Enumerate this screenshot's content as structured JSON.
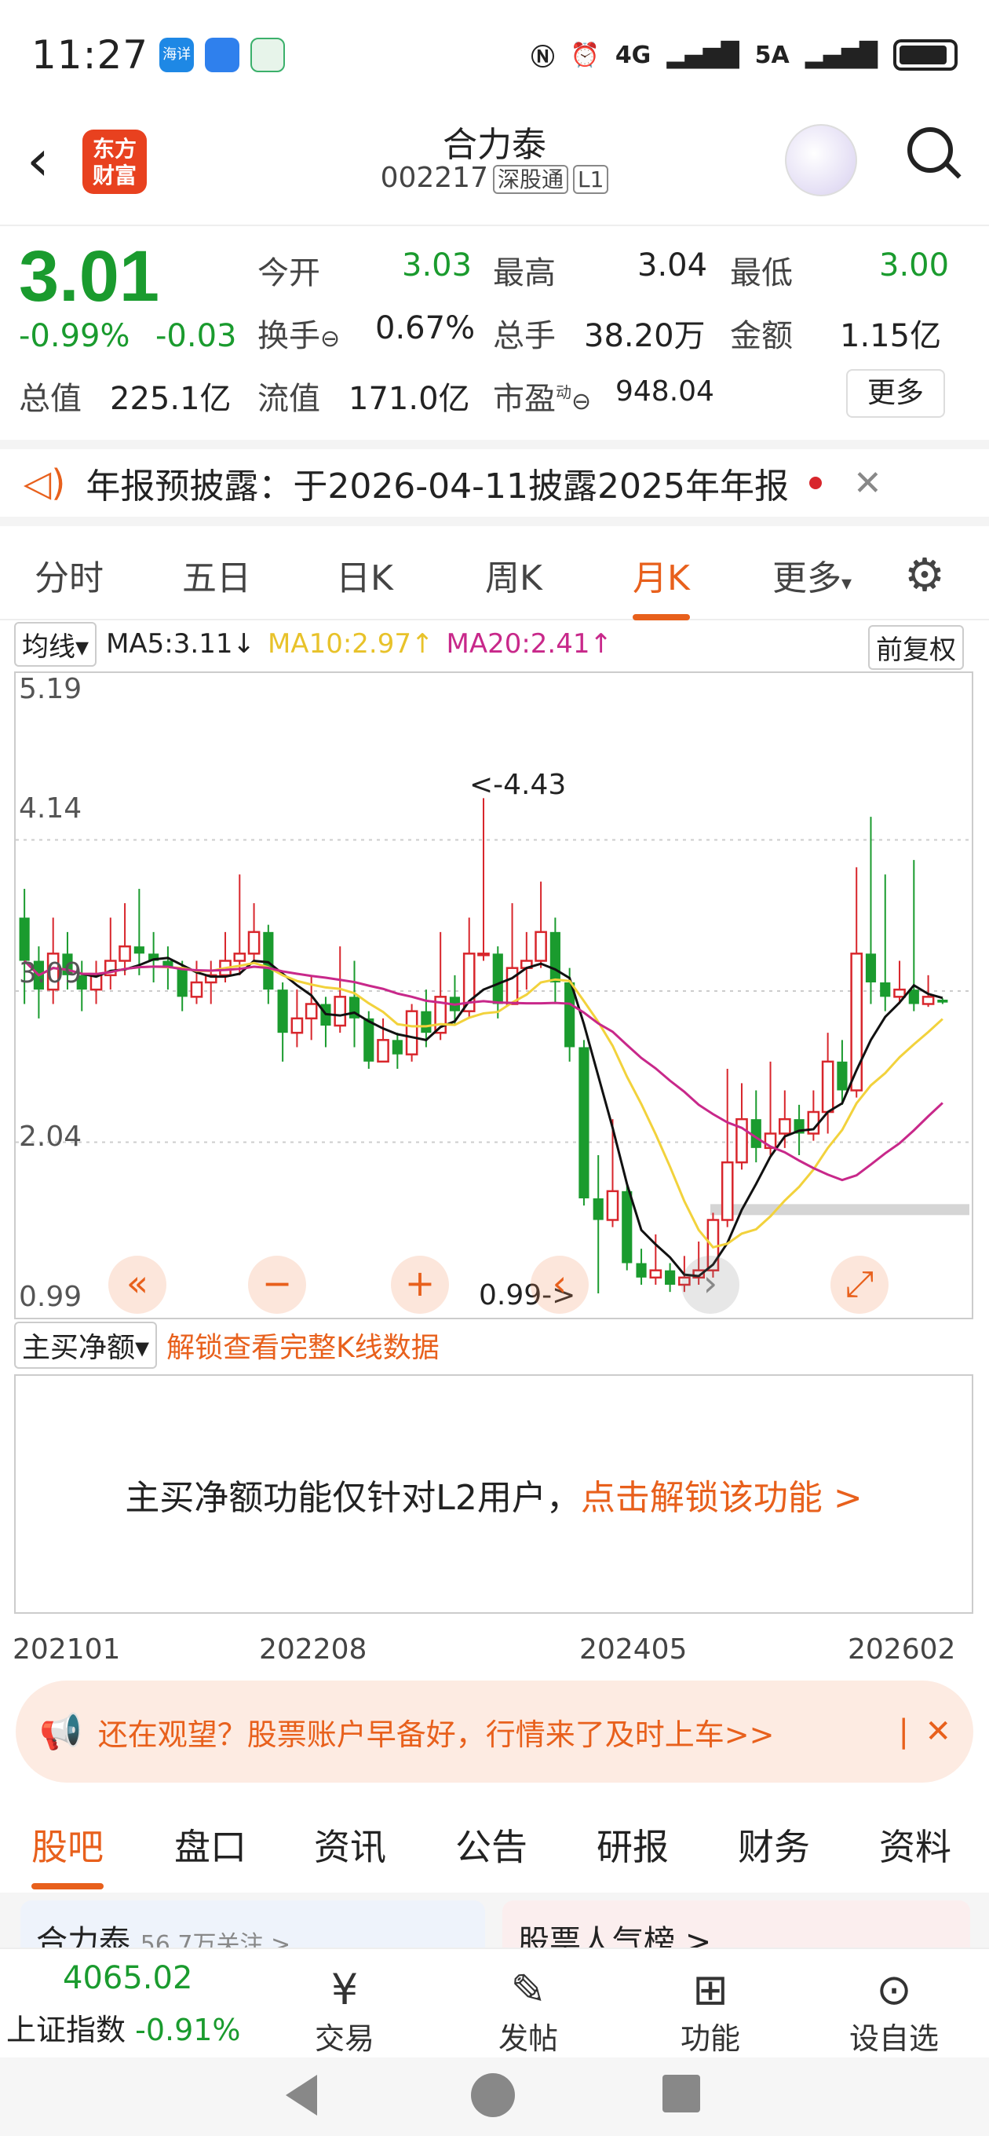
{
  "status_bar": {
    "time": "11:27",
    "apps": [
      "海详",
      "messages",
      "green-app"
    ],
    "network": "4G",
    "network2": "5A"
  },
  "header": {
    "logo_text": "东方财富",
    "stock_name": "合力泰",
    "stock_code": "002217",
    "tag1": "深股通",
    "tag2": "L1"
  },
  "quote": {
    "price": "3.01",
    "change_pct": "-0.99%",
    "change": "-0.03",
    "open_label": "今开",
    "open": "3.03",
    "high_label": "最高",
    "high": "3.04",
    "low_label": "最低",
    "low": "3.00",
    "turnover_label": "换手",
    "turnover": "0.67%",
    "volume_label": "总手",
    "volume": "38.20万",
    "amount_label": "金额",
    "amount": "1.15亿",
    "mktcap_label": "总值",
    "mktcap": "225.1亿",
    "float_label": "流值",
    "float_cap": "171.0亿",
    "pe_label": "市盈",
    "pe_sup": "动",
    "pe": "948.04",
    "more": "更多"
  },
  "notice": {
    "text": "年报预披露：于2026-04-11披露2025年年报"
  },
  "tabs": [
    "分时",
    "五日",
    "日K",
    "周K",
    "月K",
    "更多"
  ],
  "active_tab": "月K",
  "ma": {
    "selector": "均线",
    "ma5": "MA5:3.11",
    "ma10": "MA10:2.97",
    "ma20": "MA20:2.41",
    "adjust": "前复权"
  },
  "chart_labels": {
    "y_top": "5.19",
    "y2": "4.14",
    "y3": "3.09",
    "y4": "2.04",
    "y_bottom": "0.99",
    "max_mark": "<-4.43",
    "min_mark": "0.99->"
  },
  "indicator": {
    "selector": "主买净额",
    "unlock_link": "解锁查看完整K线数据",
    "msg": "主买净额功能仅针对L2用户，",
    "msg_link": "点击解锁该功能 >"
  },
  "x_dates": [
    "202101",
    "202208",
    "202405",
    "202602"
  ],
  "banner": {
    "text": "还在观望？股票账户早备好，行情来了及时上车>>"
  },
  "bottom_tabs": [
    "股吧",
    "盘口",
    "资讯",
    "公告",
    "研报",
    "财务",
    "资料"
  ],
  "cards": {
    "left": "合力泰",
    "left_sub": "56.7万关注 >",
    "right": "股票人气榜 >"
  },
  "bottom_bar": {
    "index_value": "4065.02",
    "index_name": "上证指数",
    "index_change": "-0.91%",
    "trade": "交易",
    "post": "发帖",
    "func": "功能",
    "watch": "设自选"
  },
  "colors": {
    "up": "#d8262c",
    "down": "#1a9b2e",
    "ma5": "#111111",
    "ma10": "#f2d23c",
    "ma20": "#c8288a",
    "accent": "#e8601c"
  },
  "chart_data": {
    "type": "candlestick",
    "ylim": [
      0.99,
      5.19
    ],
    "yticks": [
      5.19,
      4.14,
      3.09,
      2.04,
      0.99
    ],
    "candles": [
      [
        3.6,
        3.3,
        3.8,
        3.0
      ],
      [
        3.3,
        3.1,
        3.4,
        2.9
      ],
      [
        3.1,
        3.35,
        3.6,
        3.0
      ],
      [
        3.35,
        3.2,
        3.5,
        3.1
      ],
      [
        3.2,
        3.1,
        3.3,
        2.95
      ],
      [
        3.1,
        3.2,
        3.3,
        3.0
      ],
      [
        3.2,
        3.3,
        3.6,
        3.1
      ],
      [
        3.3,
        3.4,
        3.7,
        3.2
      ],
      [
        3.4,
        3.35,
        3.8,
        3.2
      ],
      [
        3.35,
        3.3,
        3.5,
        3.15
      ],
      [
        3.3,
        3.25,
        3.4,
        3.1
      ],
      [
        3.25,
        3.05,
        3.3,
        2.95
      ],
      [
        3.05,
        3.15,
        3.3,
        3.0
      ],
      [
        3.15,
        3.2,
        3.3,
        3.0
      ],
      [
        3.2,
        3.3,
        3.5,
        3.15
      ],
      [
        3.3,
        3.35,
        3.9,
        3.2
      ],
      [
        3.35,
        3.5,
        3.7,
        3.3
      ],
      [
        3.5,
        3.1,
        3.55,
        3.0
      ],
      [
        3.1,
        2.8,
        3.15,
        2.6
      ],
      [
        2.8,
        2.9,
        3.1,
        2.7
      ],
      [
        2.9,
        3.0,
        3.2,
        2.75
      ],
      [
        3.0,
        2.85,
        3.05,
        2.7
      ],
      [
        2.85,
        3.05,
        3.4,
        2.8
      ],
      [
        3.05,
        2.9,
        3.3,
        2.7
      ],
      [
        2.9,
        2.6,
        2.95,
        2.55
      ],
      [
        2.6,
        2.75,
        2.9,
        2.6
      ],
      [
        2.75,
        2.65,
        2.8,
        2.55
      ],
      [
        2.65,
        2.95,
        3.0,
        2.6
      ],
      [
        2.95,
        2.8,
        3.1,
        2.7
      ],
      [
        2.8,
        3.05,
        3.5,
        2.75
      ],
      [
        3.05,
        2.95,
        3.2,
        2.85
      ],
      [
        2.95,
        3.35,
        3.6,
        2.9
      ],
      [
        3.35,
        3.35,
        4.43,
        3.3
      ],
      [
        3.35,
        3.0,
        3.4,
        2.9
      ],
      [
        3.0,
        3.25,
        3.7,
        3.0
      ],
      [
        3.25,
        3.3,
        3.5,
        3.1
      ],
      [
        3.3,
        3.5,
        3.85,
        3.25
      ],
      [
        3.5,
        3.15,
        3.6,
        3.0
      ],
      [
        3.15,
        2.7,
        3.25,
        2.6
      ],
      [
        2.7,
        1.65,
        2.75,
        1.6
      ],
      [
        1.65,
        1.5,
        1.95,
        0.99
      ],
      [
        1.5,
        1.7,
        2.2,
        1.45
      ],
      [
        1.7,
        1.2,
        1.75,
        1.15
      ],
      [
        1.2,
        1.1,
        1.3,
        1.05
      ],
      [
        1.1,
        1.15,
        1.4,
        1.05
      ],
      [
        1.15,
        1.05,
        1.2,
        1.0
      ],
      [
        1.05,
        1.1,
        1.25,
        1.0
      ],
      [
        1.1,
        1.15,
        1.35,
        1.05
      ],
      [
        1.15,
        1.5,
        1.55,
        1.1
      ],
      [
        1.5,
        1.9,
        2.55,
        1.45
      ],
      [
        1.9,
        2.2,
        2.45,
        1.85
      ],
      [
        2.2,
        2.0,
        2.4,
        1.9
      ],
      [
        2.0,
        2.1,
        2.6,
        1.95
      ],
      [
        2.1,
        2.2,
        2.4,
        2.0
      ],
      [
        2.2,
        2.1,
        2.3,
        1.95
      ],
      [
        2.1,
        2.25,
        2.4,
        2.05
      ],
      [
        2.25,
        2.6,
        2.8,
        2.1
      ],
      [
        2.6,
        2.4,
        2.75,
        2.3
      ],
      [
        2.4,
        3.35,
        3.95,
        2.35
      ],
      [
        3.35,
        3.15,
        4.3,
        3.0
      ],
      [
        3.15,
        3.05,
        3.9,
        2.95
      ],
      [
        3.05,
        3.1,
        3.3,
        3.0
      ],
      [
        3.1,
        3.0,
        4.0,
        2.95
      ],
      [
        3.0,
        3.05,
        3.2,
        2.98
      ],
      [
        3.03,
        3.01,
        3.04,
        3.0
      ]
    ]
  }
}
